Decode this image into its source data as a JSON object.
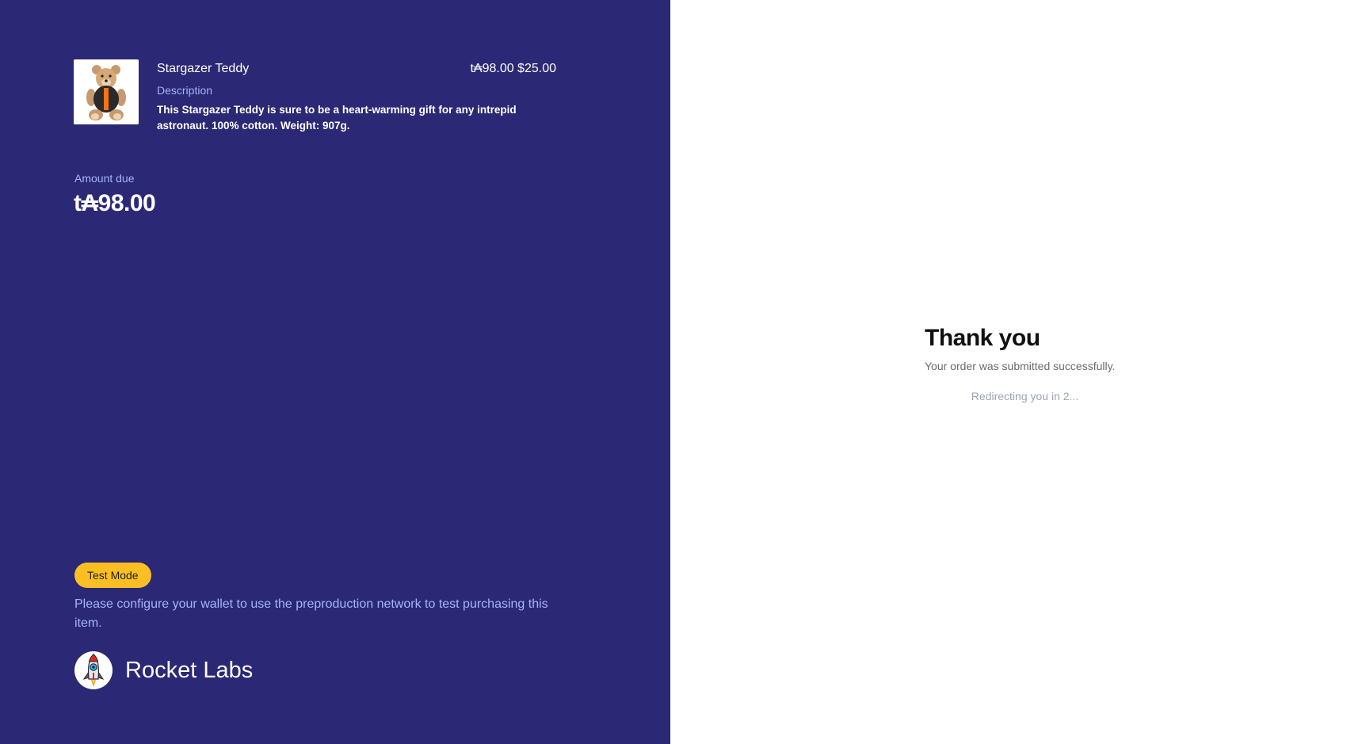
{
  "product": {
    "name": "Stargazer Teddy",
    "price": "t₳98.00 $25.00",
    "description_label": "Description",
    "description": "This Stargazer Teddy is sure to be a heart-warming gift for any intrepid astronaut. 100% cotton. Weight: 907g.",
    "image_icon": "teddy-bear-image"
  },
  "amount": {
    "label": "Amount due",
    "value": "t₳98.00"
  },
  "test_mode": {
    "badge": "Test Mode",
    "note": "Please configure your wallet to use the preproduction network to test purchasing this item."
  },
  "brand": {
    "name": "Rocket Labs",
    "logo_icon": "rocket-icon"
  },
  "confirmation": {
    "title": "Thank you",
    "subtitle": "Your order was submitted successfully.",
    "redirect": "Redirecting you in 2..."
  },
  "colors": {
    "left_panel_bg": "#2b2875",
    "accent_label": "#a5b4fc",
    "badge_bg": "#fbbf24",
    "right_panel_bg": "#ffffff"
  }
}
